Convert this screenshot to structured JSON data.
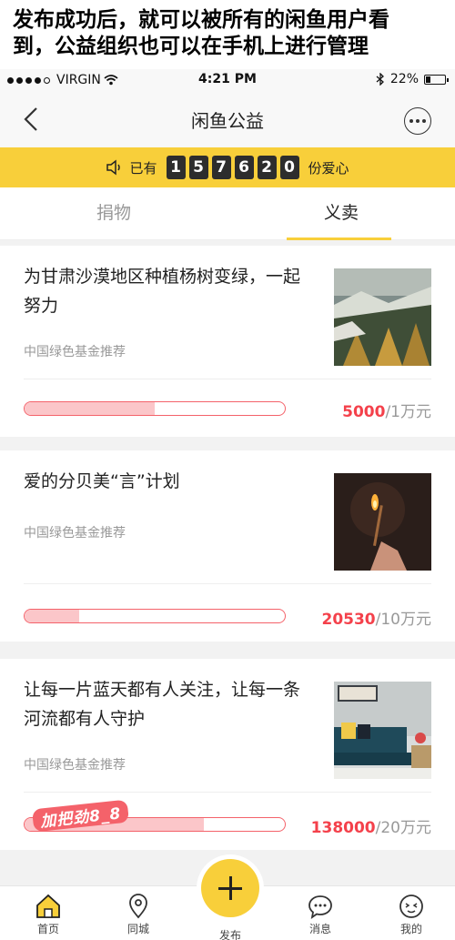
{
  "caption": {
    "line1": "发布成功后，就可以被所有的闲鱼用户看",
    "line2": "到，公益组织也可以在手机上进行管理"
  },
  "status_bar": {
    "carrier": "VIRGIN",
    "time": "4:21 PM",
    "battery": "22%",
    "battery_level": 0.22
  },
  "nav": {
    "title": "闲鱼公益"
  },
  "banner": {
    "prefix": "已有",
    "digits": [
      "1",
      "5",
      "7",
      "6",
      "2",
      "0"
    ],
    "suffix": "份爱心"
  },
  "tabs": [
    {
      "label": "捐物",
      "active": false
    },
    {
      "label": "义卖",
      "active": true
    }
  ],
  "items": [
    {
      "title": "为甘肃沙漠地区种植杨树变绿，一起努力",
      "source": "中国绿色基金推荐",
      "raised": "5000",
      "goal": "/1万元",
      "progress": 0.5
    },
    {
      "title": "爱的分贝美“言”计划",
      "source": "中国绿色基金推荐",
      "raised": "20530",
      "goal": "/10万元",
      "progress": 0.21
    },
    {
      "title": "让每一片蓝天都有人关注，让每一条河流都有人守护",
      "source": "中国绿色基金推荐",
      "raised": "138000",
      "goal": "/20万元",
      "progress": 0.69,
      "sticker": "加把劲8_8"
    }
  ],
  "tabbar": {
    "home": "首页",
    "nearby": "同城",
    "publish": "发布",
    "messages": "消息",
    "mine": "我的"
  },
  "colors": {
    "accent": "#f8cf3a",
    "progress_border": "#f4626a",
    "progress_fill": "#fbc6c9",
    "amount_red": "#f4414b"
  }
}
